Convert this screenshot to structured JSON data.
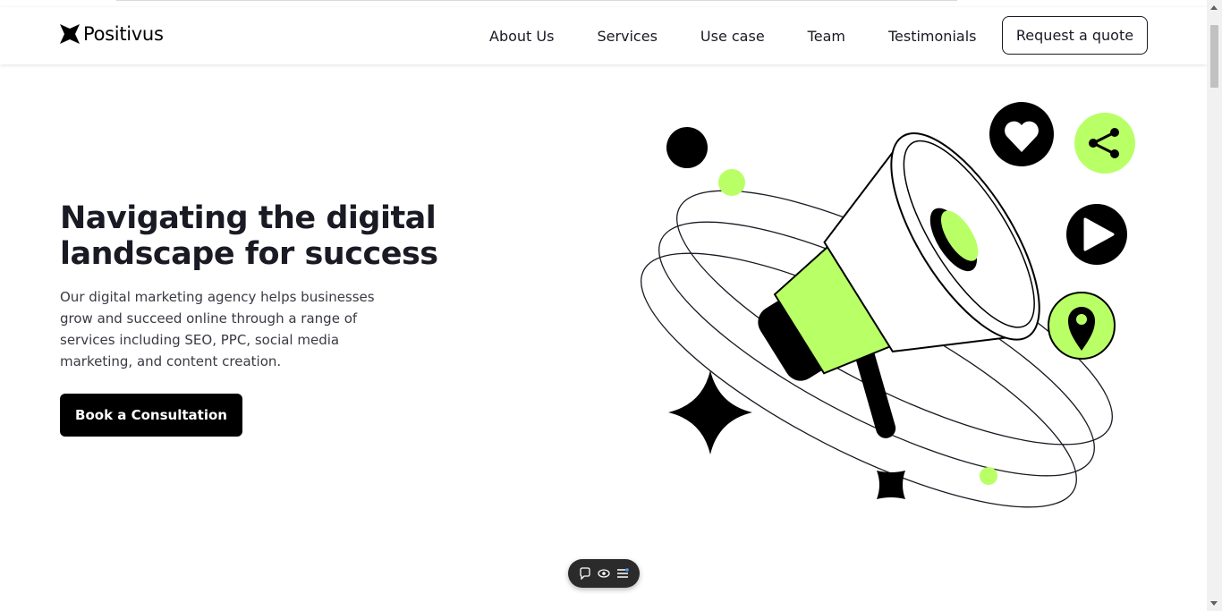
{
  "header": {
    "logo_text": "Positivus",
    "nav": [
      {
        "label": "About Us"
      },
      {
        "label": "Services"
      },
      {
        "label": "Use case"
      },
      {
        "label": "Team"
      },
      {
        "label": "Testimonials"
      }
    ],
    "quote_button": "Request a quote"
  },
  "hero": {
    "title_line1": "Navigating the digital",
    "title_line2": "landscape for success",
    "description": "Our digital marketing agency helps businesses grow and succeed online through a range of services including SEO, PPC, social media marketing, and content creation.",
    "cta_button": "Book a Consultation"
  },
  "illustration": {
    "icons": [
      "megaphone-icon",
      "heart-icon",
      "share-icon",
      "play-icon",
      "location-pin-icon",
      "sparkle-star-icon"
    ]
  },
  "floating_toolbar": {
    "icons": [
      "chat-bubble-icon",
      "eye-icon",
      "menu-icon"
    ]
  },
  "colors": {
    "accent": "#B9FF66",
    "dark": "#191A23",
    "black": "#000000"
  }
}
